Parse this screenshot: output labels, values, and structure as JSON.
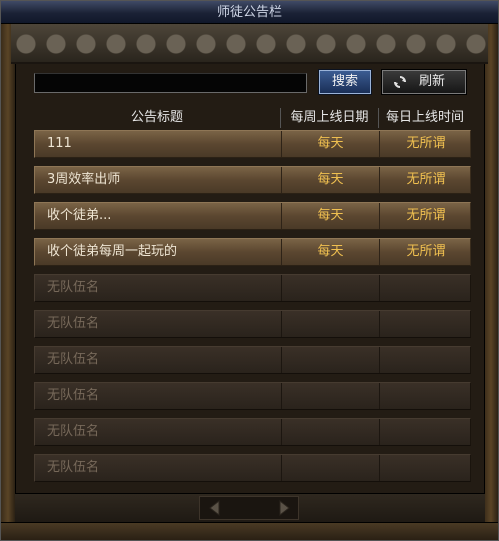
{
  "window": {
    "title": "师徒公告栏"
  },
  "search": {
    "value": "",
    "button_label": "搜索"
  },
  "refresh": {
    "button_label": "刷新",
    "icon": "refresh-icon"
  },
  "table": {
    "columns": [
      "公告标题",
      "每周上线日期",
      "每日上线时间"
    ],
    "rows": [
      {
        "title": "111",
        "week": "每天",
        "time": "无所谓",
        "filled": true
      },
      {
        "title": "3周效率出师",
        "week": "每天",
        "time": "无所谓",
        "filled": true
      },
      {
        "title": "收个徒弟...",
        "week": "每天",
        "time": "无所谓",
        "filled": true
      },
      {
        "title": "收个徒弟每周一起玩的",
        "week": "每天",
        "time": "无所谓",
        "filled": true
      },
      {
        "title": "无队伍名",
        "week": "",
        "time": "",
        "filled": false
      },
      {
        "title": "无队伍名",
        "week": "",
        "time": "",
        "filled": false
      },
      {
        "title": "无队伍名",
        "week": "",
        "time": "",
        "filled": false
      },
      {
        "title": "无队伍名",
        "week": "",
        "time": "",
        "filled": false
      },
      {
        "title": "无队伍名",
        "week": "",
        "time": "",
        "filled": false
      },
      {
        "title": "无队伍名",
        "week": "",
        "time": "",
        "filled": false
      }
    ]
  },
  "pager": {
    "prev_icon": "arrow-left-icon",
    "next_icon": "arrow-right-icon"
  },
  "colors": {
    "filled_text": "#efe6d4",
    "accent_text": "#f0c050",
    "empty_text": "#77695a",
    "search_button": "#2a4a7e"
  }
}
